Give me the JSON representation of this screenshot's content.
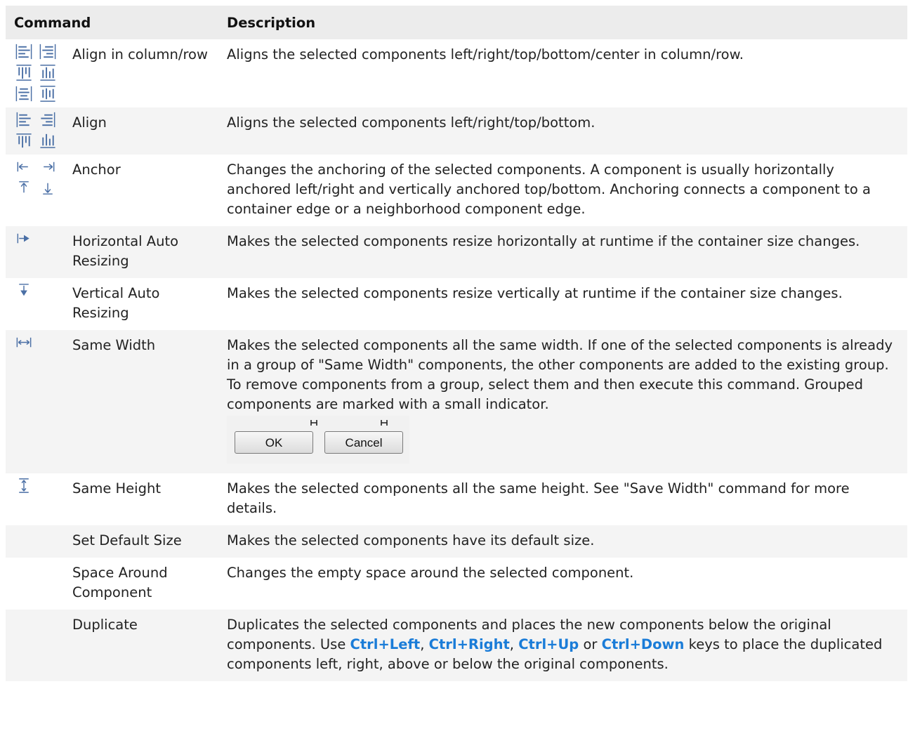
{
  "table": {
    "headers": {
      "command": "Command",
      "description": "Description"
    },
    "rows": [
      {
        "name": "Align in column/row",
        "desc": "Aligns the selected components left/right/top/bottom/center in column/row.",
        "icons": [
          "align-left-in-column-icon",
          "align-right-in-column-icon",
          "align-top-in-row-icon",
          "align-bottom-in-row-icon",
          "align-center-in-column-icon",
          "align-center-in-row-icon"
        ]
      },
      {
        "name": "Align",
        "desc": "Aligns the selected components left/right/top/bottom.",
        "icons": [
          "align-left-icon",
          "align-right-icon",
          "align-top-icon",
          "align-bottom-icon"
        ]
      },
      {
        "name": "Anchor",
        "desc": "Changes the anchoring of the selected components. A component is usually horizontally anchored left/right and vertically anchored top/bottom. Anchoring connects a component to a container edge or a neighborhood component edge.",
        "icons": [
          "anchor-left-icon",
          "anchor-right-icon",
          "anchor-top-icon",
          "anchor-bottom-icon"
        ]
      },
      {
        "name": "Horizontal Auto Resizing",
        "desc": "Makes the selected components resize horizontally at runtime if the container size changes.",
        "icons": [
          "horizontal-auto-resize-icon"
        ]
      },
      {
        "name": "Vertical Auto Resizing",
        "desc": "Makes the selected components resize vertically at runtime if the container size changes.",
        "icons": [
          "vertical-auto-resize-icon"
        ]
      },
      {
        "name": "Same Width",
        "desc": "Makes the selected components all the same width. If one of the selected components is already in a group of \"Same Width\" components, the other components are added to the existing group. To remove components from a group, select them and then execute this command. Grouped components are marked with a small indicator.",
        "icons": [
          "same-width-icon"
        ],
        "example": {
          "ok_label": "OK",
          "cancel_label": "Cancel"
        }
      },
      {
        "name": "Same Height",
        "desc": "Makes the selected components all the same height. See \"Save Width\" command for more details.",
        "icons": [
          "same-height-icon"
        ]
      },
      {
        "name": "Set Default Size",
        "desc": "Makes the selected components have its default size.",
        "icons": []
      },
      {
        "name": "Space Around Component",
        "desc": "Changes the empty space around the selected component.",
        "icons": []
      },
      {
        "name": "Duplicate",
        "desc_parts": [
          "Duplicates the selected components and places the new components below the original components. Use ",
          "Ctrl+Left",
          ", ",
          "Ctrl+Right",
          ", ",
          "Ctrl+Up",
          " or ",
          "Ctrl+Down",
          " keys to place the duplicated components left, right, above or below the original components."
        ],
        "icons": []
      }
    ]
  },
  "colors": {
    "header_bg": "#ececec",
    "alt_row_bg": "#f4f4f4",
    "link": "#1a7cd8",
    "icon": "#4a6fa5"
  }
}
